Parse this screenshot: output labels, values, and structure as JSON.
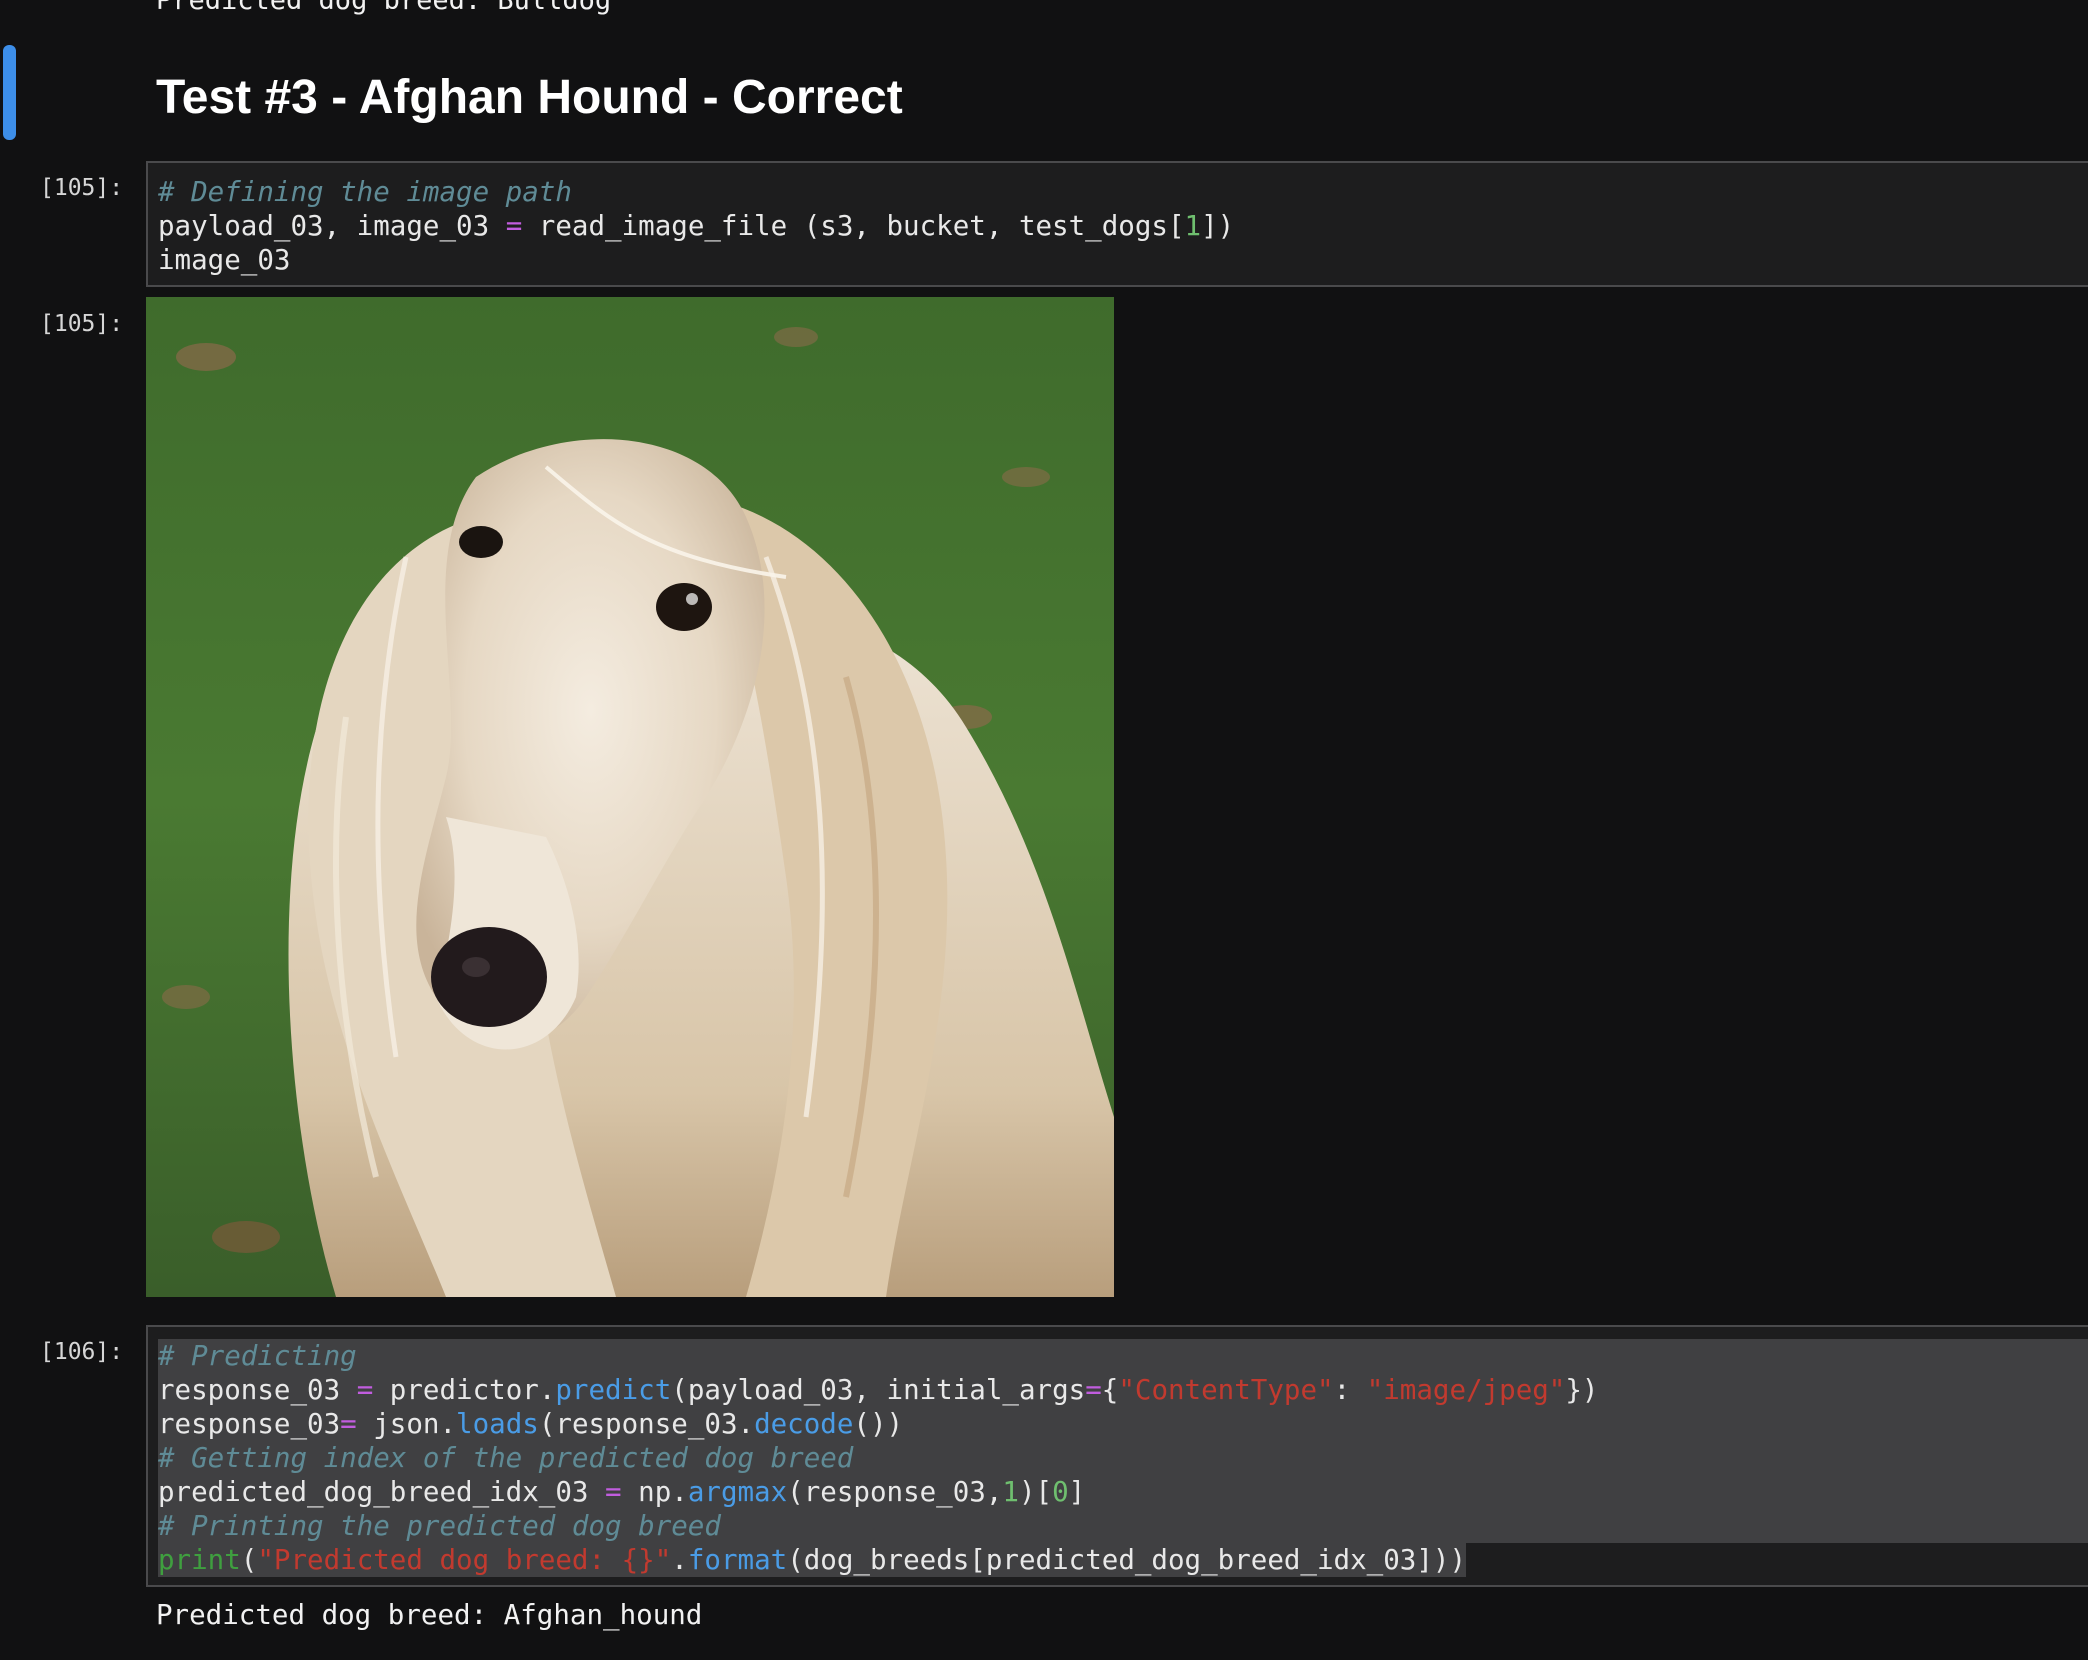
{
  "previous_output": "Predicted dog breed: Bulldog",
  "heading": "Test #3 - Afghan Hound - Correct",
  "cells": {
    "c105_input": {
      "prompt": "[105]:",
      "comment": "# Defining the image path",
      "line2": {
        "a": "payload_03, image_03 ",
        "op": "=",
        "b": " read_image_file (s3, bucket, test_dogs[",
        "num": "1",
        "c": "])"
      },
      "line3": "image_03"
    },
    "c105_output": {
      "prompt": "[105]:",
      "image_alt": "Afghan hound photo on grass",
      "icon": "dog-photo"
    },
    "c106_input": {
      "prompt": "[106]:",
      "l1_comment": "# Predicting",
      "l2": {
        "a": "response_03 ",
        "op": "=",
        "b": " predictor.",
        "fn": "predict",
        "c": "(payload_03, initial_args",
        "op2": "=",
        "d": "{",
        "s1": "\"ContentType\"",
        "e": ": ",
        "s2": "\"image/jpeg\"",
        "f": "})"
      },
      "l3": {
        "a": "response_03",
        "op": "=",
        "b": " json.",
        "fn": "loads",
        "c": "(response_03.",
        "fn2": "decode",
        "d": "())"
      },
      "l4_comment": "# Getting index of the predicted dog breed",
      "l5": {
        "a": "predicted_dog_breed_idx_03 ",
        "op": "=",
        "b": " np.",
        "fn": "argmax",
        "c": "(response_03,",
        "num": "1",
        "d": ")[",
        "num2": "0",
        "e": "]"
      },
      "l6_comment": "# Printing the predicted dog breed",
      "l7": {
        "builtin": "print",
        "a": "(",
        "s": "\"Predicted dog breed: {}\"",
        "b": ".",
        "fn": "format",
        "c": "(dog_breeds[predicted_dog_breed_idx_03]))"
      }
    },
    "c106_output": {
      "text": "Predicted dog breed: Afghan_hound"
    }
  },
  "colors": {
    "background": "#111112",
    "accent": "#3d8ee8",
    "comment": "#5f8b96",
    "operator": "#c15ddf",
    "number": "#6fbf6f",
    "string": "#c23a2f",
    "function": "#4a9ce6"
  }
}
